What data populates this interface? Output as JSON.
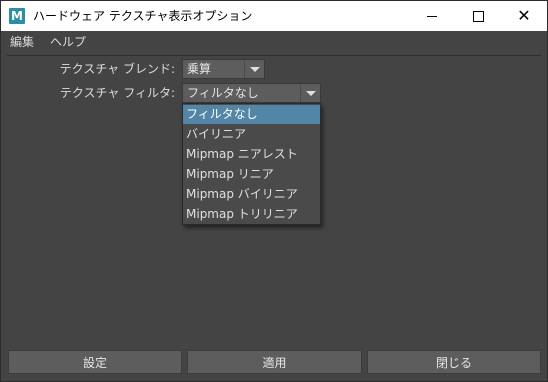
{
  "window": {
    "title": "ハードウェア テクスチャ表示オプション",
    "app_icon_letter": "M",
    "controls": {
      "minimize": "minimize",
      "maximize": "maximize",
      "close": "✕"
    }
  },
  "menubar": {
    "items": [
      "編集",
      "ヘルプ"
    ]
  },
  "form": {
    "blend": {
      "label": "テクスチャ ブレンド:",
      "value": "乗算"
    },
    "filter": {
      "label": "テクスチャ フィルタ:",
      "value": "フィルタなし"
    }
  },
  "filter_options": {
    "selected_index": 0,
    "items": [
      "フィルタなし",
      "バイリニア",
      "Mipmap ニアレスト",
      "Mipmap リニア",
      "Mipmap バイリニア",
      "Mipmap トリリニア"
    ]
  },
  "buttons": {
    "settings": "設定",
    "apply": "適用",
    "close": "閉じる"
  },
  "colors": {
    "background": "#444444",
    "accent": "#5285a6"
  }
}
